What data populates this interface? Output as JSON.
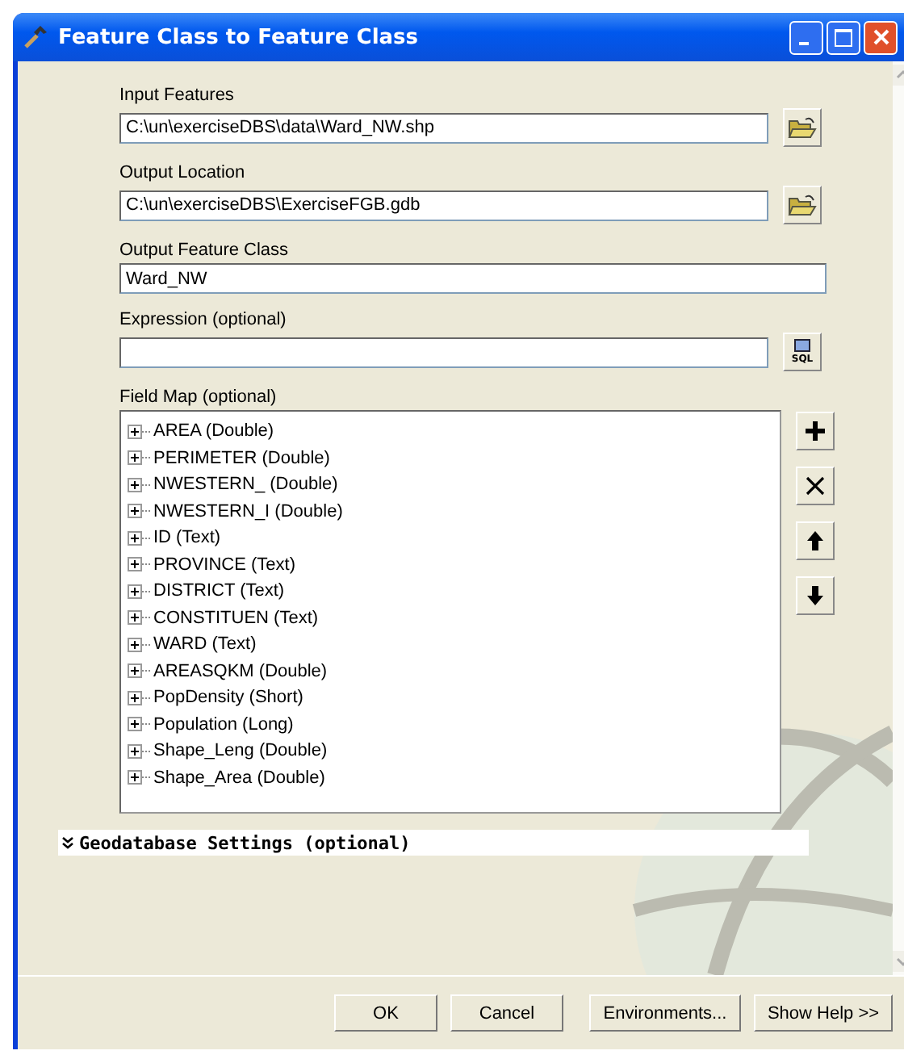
{
  "window": {
    "title": "Feature Class to Feature Class"
  },
  "parameters": [
    {
      "label": "Input Features",
      "value": "C:\\un\\exerciseDBS\\data\\Ward_NW.shp",
      "kind": "browse"
    },
    {
      "label": "Output Location",
      "value": "C:\\un\\exerciseDBS\\ExerciseFGB.gdb",
      "kind": "browse"
    },
    {
      "label": "Output Feature Class",
      "value": "Ward_NW",
      "kind": "plain"
    },
    {
      "label": "Expression (optional)",
      "kind": "sql",
      "button_text": "SQL"
    }
  ],
  "field_map": {
    "label": "Field Map (optional)",
    "items": [
      {
        "label": "AREA (Double)",
        "expanded": false
      },
      {
        "label": "PERIMETER (Double)",
        "expanded": false
      },
      {
        "label": "NWESTERN_ (Double)",
        "expanded": false
      },
      {
        "label": "NWESTERN_I (Double)",
        "expanded": false
      },
      {
        "label": "ID (Text)",
        "expanded": false
      },
      {
        "label": "PROVINCE (Text)",
        "expanded": false
      },
      {
        "label": "DISTRICT (Text)",
        "expanded": false
      },
      {
        "label": "CONSTITUEN (Text)",
        "expanded": false
      },
      {
        "label": "WARD (Text)",
        "expanded": false
      },
      {
        "label": "AREASQKM (Double)",
        "expanded": false
      },
      {
        "label": "PopDensity (Short)",
        "expanded": false
      },
      {
        "label": "Population (Long)",
        "expanded": false
      },
      {
        "label": "Shape_Leng (Double)",
        "expanded": false
      },
      {
        "label": "Shape_Area (Double)",
        "expanded": false
      }
    ]
  },
  "geodatabase_settings": {
    "label": "Geodatabase Settings (optional)",
    "expanded": false
  },
  "buttons": [
    "OK",
    "Cancel",
    "Environments...",
    "Show Help >>"
  ]
}
